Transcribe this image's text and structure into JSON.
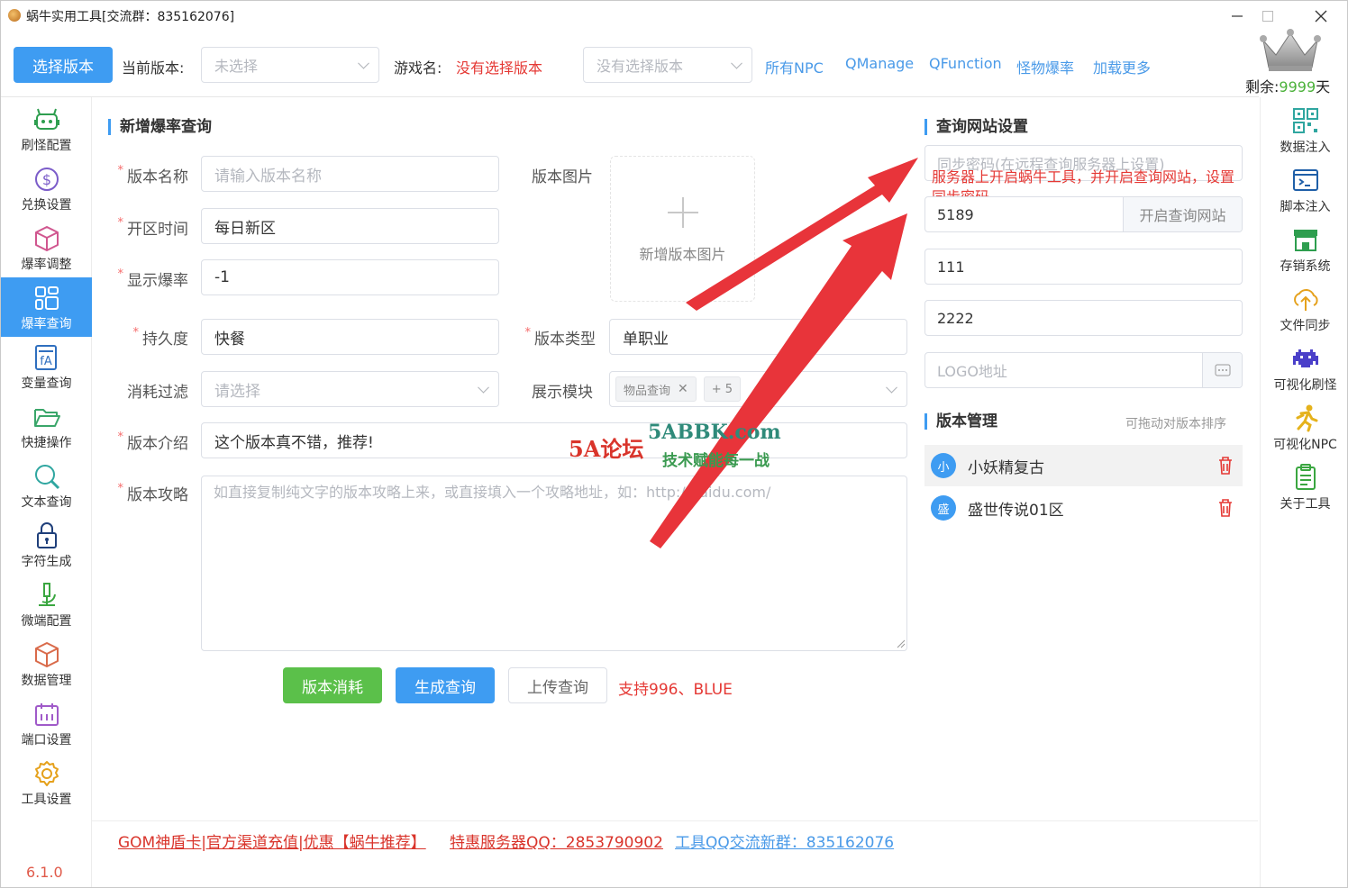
{
  "window": {
    "title": "蜗牛实用工具[交流群：835162076]"
  },
  "toolbar": {
    "select_version_label": "选择版本",
    "current_version_label": "当前版本:",
    "current_version_value": "未选择",
    "game_name_label": "游戏名:",
    "game_name_value": "没有选择版本",
    "second_select_value": "没有选择版本",
    "links": [
      "所有NPC",
      "QManage",
      "QFunction",
      "怪物爆率",
      "加载更多"
    ],
    "remaining_label": "剩余:",
    "remaining_value": "9999",
    "remaining_unit": "天"
  },
  "sidebar": {
    "items": [
      {
        "label": "刷怪配置",
        "icon": "robot-icon"
      },
      {
        "label": "兑换设置",
        "icon": "dollar-coin-icon"
      },
      {
        "label": "爆率调整",
        "icon": "cube-icon"
      },
      {
        "label": "爆率查询",
        "icon": "layout-icon"
      },
      {
        "label": "变量查询",
        "icon": "formula-icon"
      },
      {
        "label": "快捷操作",
        "icon": "folder-open-icon"
      },
      {
        "label": "文本查询",
        "icon": "magnifier-icon"
      },
      {
        "label": "字符生成",
        "icon": "lock-icon"
      },
      {
        "label": "微端配置",
        "icon": "microscope-icon"
      },
      {
        "label": "数据管理",
        "icon": "box-icon"
      },
      {
        "label": "端口设置",
        "icon": "calendar-icon"
      },
      {
        "label": "工具设置",
        "icon": "gear-icon"
      }
    ],
    "active_index": 3,
    "version": "6.1.0"
  },
  "right_sidebar": {
    "items": [
      {
        "label": "数据注入",
        "icon": "qr-code-icon"
      },
      {
        "label": "脚本注入",
        "icon": "terminal-icon"
      },
      {
        "label": "存销系统",
        "icon": "store-icon"
      },
      {
        "label": "文件同步",
        "icon": "cloud-sync-icon"
      },
      {
        "label": "可视化刷怪",
        "icon": "space-invader-icon"
      },
      {
        "label": "可视化NPC",
        "icon": "runner-icon"
      },
      {
        "label": "关于工具",
        "icon": "clipboard-icon"
      }
    ]
  },
  "form": {
    "title": "新增爆率查询",
    "version_name_label": "版本名称",
    "version_name_placeholder": "请输入版本名称",
    "open_time_label": "开区时间",
    "open_time_value": "每日新区",
    "show_rate_label": "显示爆率",
    "show_rate_value": "-1",
    "durability_label": "持久度",
    "durability_value": "快餐",
    "consume_filter_label": "消耗过滤",
    "consume_filter_placeholder": "请选择",
    "intro_label": "版本介绍",
    "intro_value": "这个版本真不错，推荐!",
    "guide_label": "版本攻略",
    "guide_placeholder": "如直接复制纯文字的版本攻略上来，或直接填入一个攻略地址，如：http://baidu.com/",
    "image_label": "版本图片",
    "image_upload_label": "新增版本图片",
    "type_label": "版本类型",
    "type_value": "单职业",
    "module_label": "展示模块",
    "module_tag": "物品查询",
    "module_more": "+ 5",
    "btn_consume": "版本消耗",
    "btn_generate": "生成查询",
    "btn_upload": "上传查询",
    "support_text": "支持996、BLUE"
  },
  "query_site": {
    "title": "查询网站设置",
    "sync_password_placeholder": "同步密码(在远程查询服务器上设置)",
    "annotation": "服务器上开启蜗牛工具，并开启查询网站，设置同步密码",
    "port_value": "5189",
    "open_site_label": "开启查询网站",
    "field3_value": "111",
    "field4_value": "2222",
    "logo_placeholder": "LOGO地址"
  },
  "version_mgmt": {
    "title": "版本管理",
    "hint": "可拖动对版本排序",
    "items": [
      {
        "avatar": "小",
        "name": "小妖精复古"
      },
      {
        "avatar": "盛",
        "name": "盛世传说01区"
      }
    ]
  },
  "footer": {
    "link1": "GOM神盾卡|官方渠道充值|优惠【蜗牛推荐】",
    "link2": "特惠服务器QQ：2853790902",
    "link3": "工具QQ交流新群：835162076"
  },
  "watermark": {
    "main": "5ABBK.com",
    "sub": "技术赋能每一战",
    "forum": "5A论坛"
  },
  "colors": {
    "accent": "#3e9cf2",
    "green": "#5bc04a",
    "red": "#e53935",
    "link": "#4a9ae8"
  }
}
